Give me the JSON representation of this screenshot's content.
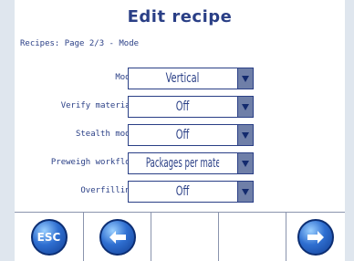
{
  "header": {
    "title": "Edit recipe",
    "subtitle": "Recipes: Page 2/3 - Mode"
  },
  "fields": [
    {
      "label": "Mode",
      "value": "Vertical"
    },
    {
      "label": "Verify material",
      "value": "Off"
    },
    {
      "label": "Stealth mode",
      "value": "Off"
    },
    {
      "label": "Preweigh workflow",
      "value": "Packages per material"
    },
    {
      "label": "Overfilling",
      "value": "Off"
    }
  ],
  "toolbar": {
    "esc_label": "ESC",
    "buttons": [
      "esc-icon",
      "arrow-left-icon",
      "empty",
      "empty",
      "arrow-right-icon"
    ]
  },
  "colors": {
    "text": "#2a3f86",
    "button": "#2f6fd1",
    "dropdown_arrow_bg": "#6f7fa8"
  }
}
